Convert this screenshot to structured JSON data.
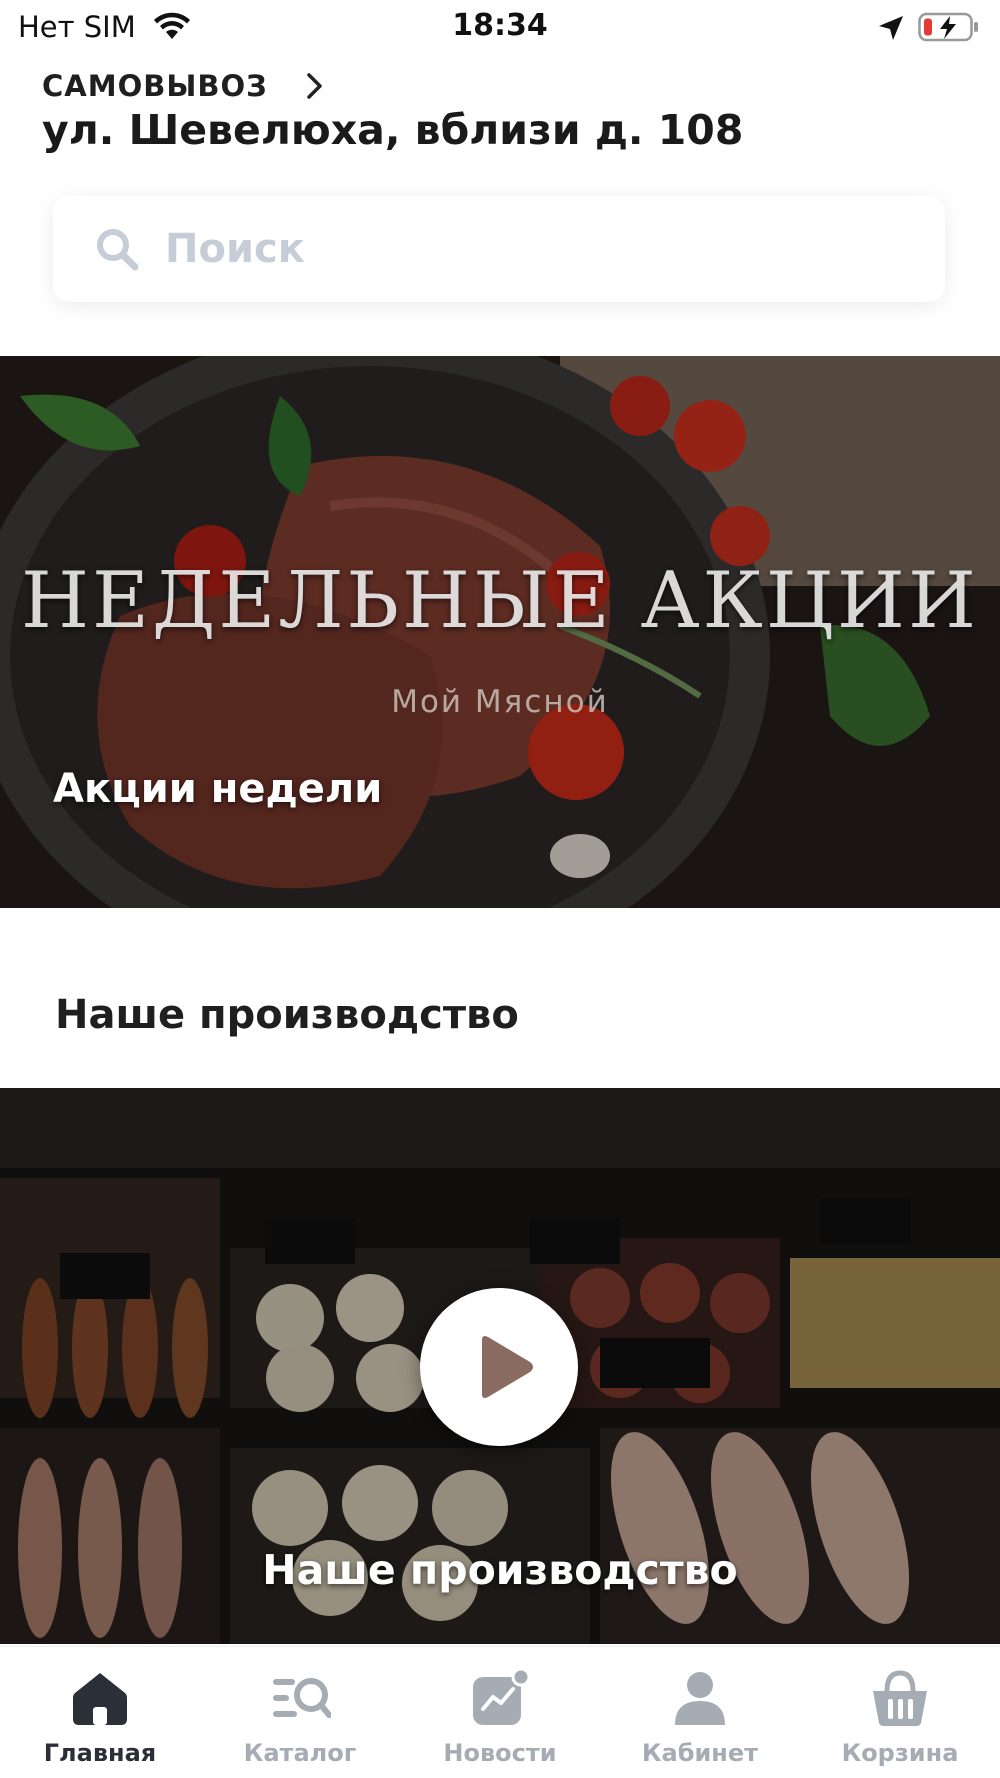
{
  "status_bar": {
    "carrier": "Нет SIM",
    "time": "18:34"
  },
  "header": {
    "pickup_label": "САМОВЫВОЗ",
    "address": "ул. Шевелюха, вблизи д. 108"
  },
  "search": {
    "placeholder": "Поиск",
    "value": ""
  },
  "promo_banner": {
    "headline": "НЕДЕЛЬНЫЕ АКЦИИ",
    "brand": "Мой Мясной",
    "caption": "Акции недели"
  },
  "production_section": {
    "title": "Наше производство",
    "video_caption": "Наше производство"
  },
  "bottom_nav": {
    "items": [
      {
        "label": "Главная",
        "icon": "home-icon",
        "active": true
      },
      {
        "label": "Каталог",
        "icon": "catalog-search-icon",
        "active": false
      },
      {
        "label": "Новости",
        "icon": "news-chart-icon",
        "active": false
      },
      {
        "label": "Кабинет",
        "icon": "user-icon",
        "active": false
      },
      {
        "label": "Корзина",
        "icon": "basket-icon",
        "active": false
      }
    ]
  },
  "colors": {
    "active_nav": "#2b2f38",
    "inactive_nav": "#a6acb4",
    "placeholder": "#c7cdd6",
    "battery_low": "#e53935"
  }
}
